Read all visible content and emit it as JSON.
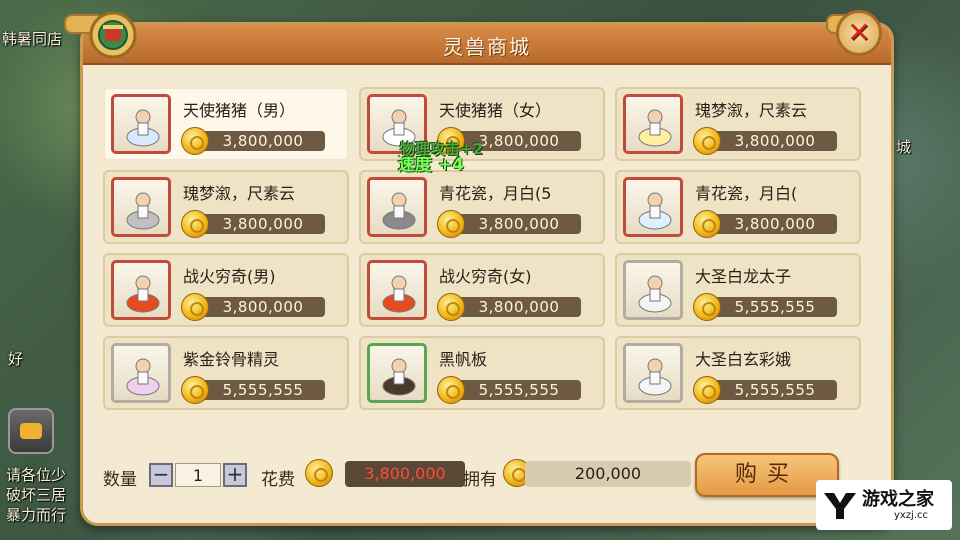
{
  "background": {
    "texts": [
      "韩暑同店",
      "城",
      "好",
      "请各位少",
      "破坏三居",
      "暴力而行"
    ]
  },
  "shop": {
    "title": "灵兽商城",
    "items": [
      {
        "name": "天使猪猪（男）",
        "price": "3,800,000",
        "frame": "red",
        "selected": true
      },
      {
        "name": "天使猪猪（女）",
        "price": "3,800,000",
        "frame": "red",
        "selected": false
      },
      {
        "name": "瑰梦溆，尺素云",
        "price": "3,800,000",
        "frame": "red",
        "selected": false
      },
      {
        "name": "瑰梦溆，尺素云",
        "price": "3,800,000",
        "frame": "red",
        "selected": false
      },
      {
        "name": "青花瓷，月白(5",
        "price": "3,800,000",
        "frame": "red",
        "selected": false
      },
      {
        "name": "青花瓷，月白(",
        "price": "3,800,000",
        "frame": "red",
        "selected": false
      },
      {
        "name": "战火穷奇(男)",
        "price": "3,800,000",
        "frame": "red",
        "selected": false
      },
      {
        "name": "战火穷奇(女)",
        "price": "3,800,000",
        "frame": "red",
        "selected": false
      },
      {
        "name": "大圣白龙太子",
        "price": "5,555,555",
        "frame": "gray",
        "selected": false
      },
      {
        "name": "紫金铃骨精灵",
        "price": "5,555,555",
        "frame": "gray",
        "selected": false
      },
      {
        "name": "黑帆板",
        "price": "5,555,555",
        "frame": "green",
        "selected": false
      },
      {
        "name": "大圣白玄彩娥",
        "price": "5,555,555",
        "frame": "gray",
        "selected": false
      }
    ],
    "floating_text": "速度 +4",
    "floating_ghost": "物理攻击+2"
  },
  "purchase": {
    "qty_label": "数量",
    "minus": "−",
    "qty": "1",
    "plus": "+",
    "cost_label": "花费",
    "cost": "3,800,000",
    "own_label": "拥有",
    "own": "200,000",
    "buy_label": "购买"
  },
  "watermark": {
    "brand": "游戏之家",
    "url": "yxzj.cc"
  },
  "colors": {
    "price_red": "#ff4a3a",
    "title_bar": "#c8783a",
    "panel_bg": "#f4ead2"
  }
}
